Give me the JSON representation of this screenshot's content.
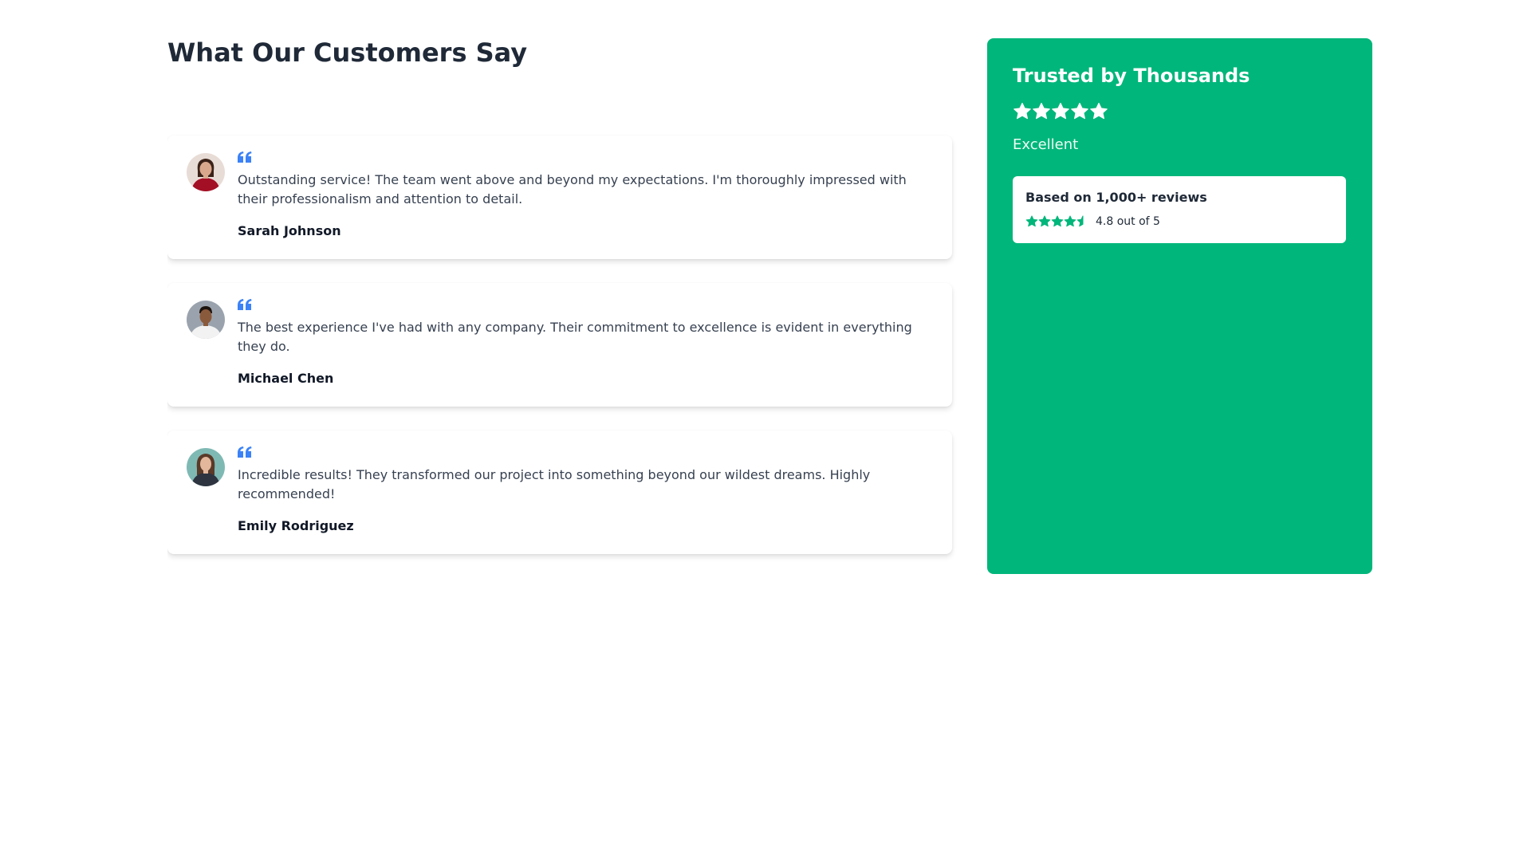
{
  "section": {
    "title": "What Our Customers Say"
  },
  "testimonials": [
    {
      "quote": "Outstanding service! The team went above and beyond my expectations. I'm thoroughly impressed with their professionalism and attention to detail.",
      "author": "Sarah Johnson"
    },
    {
      "quote": "The best experience I've had with any company. Their commitment to excellence is evident in everything they do.",
      "author": "Michael Chen"
    },
    {
      "quote": "Incredible results! They transformed our project into something beyond our wildest dreams. Highly recommended!",
      "author": "Emily Rodriguez"
    },
    {
      "quote": "",
      "author": ""
    }
  ],
  "trust": {
    "title": "Trusted by Thousands",
    "rating_word": "Excellent",
    "stars_filled": 5,
    "reviews_label": "Based on 1,000+ reviews",
    "score_text": "4.8 out of 5",
    "score_value": 4.8,
    "score_max": 5
  },
  "colors": {
    "trust_green": "#00b67a",
    "quote_blue": "#3b82f6",
    "heading": "#1f2937"
  },
  "icons": {
    "quote": "quote-icon",
    "star": "star-icon"
  }
}
